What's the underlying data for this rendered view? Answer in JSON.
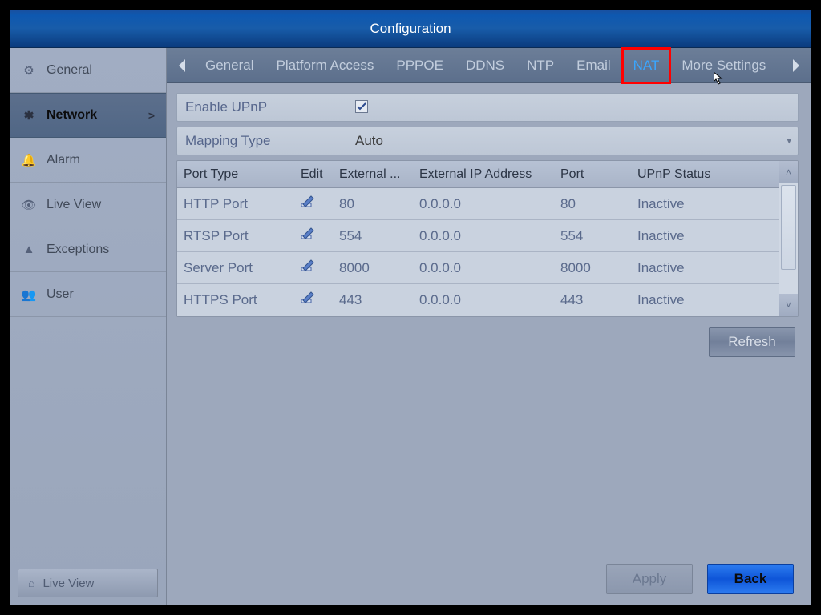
{
  "title": "Configuration",
  "sidebar": {
    "items": [
      {
        "icon": "gear-icon",
        "label": "General"
      },
      {
        "icon": "network-icon",
        "label": "Network",
        "active": true
      },
      {
        "icon": "bell-icon",
        "label": "Alarm"
      },
      {
        "icon": "eye-icon",
        "label": "Live View"
      },
      {
        "icon": "warn-icon",
        "label": "Exceptions"
      },
      {
        "icon": "user-icon",
        "label": "User"
      }
    ],
    "bottom": {
      "icon": "home-icon",
      "label": "Live View"
    }
  },
  "tabs": {
    "items": [
      "General",
      "Platform Access",
      "PPPOE",
      "DDNS",
      "NTP",
      "Email",
      "NAT",
      "More Settings"
    ],
    "active": "NAT",
    "highlighted": "NAT"
  },
  "form": {
    "enable_upnp_label": "Enable UPnP",
    "enable_upnp_checked": true,
    "mapping_type_label": "Mapping Type",
    "mapping_type_value": "Auto"
  },
  "table": {
    "headers": {
      "type": "Port Type",
      "edit": "Edit",
      "extp": "External ...",
      "extip": "External IP Address",
      "port": "Port",
      "status": "UPnP Status"
    },
    "rows": [
      {
        "type": "HTTP Port",
        "extp": "80",
        "extip": "0.0.0.0",
        "port": "80",
        "status": "Inactive"
      },
      {
        "type": "RTSP Port",
        "extp": "554",
        "extip": "0.0.0.0",
        "port": "554",
        "status": "Inactive"
      },
      {
        "type": "Server Port",
        "extp": "8000",
        "extip": "0.0.0.0",
        "port": "8000",
        "status": "Inactive"
      },
      {
        "type": "HTTPS Port",
        "extp": "443",
        "extip": "0.0.0.0",
        "port": "443",
        "status": "Inactive"
      }
    ]
  },
  "buttons": {
    "refresh": "Refresh",
    "apply": "Apply",
    "back": "Back"
  }
}
